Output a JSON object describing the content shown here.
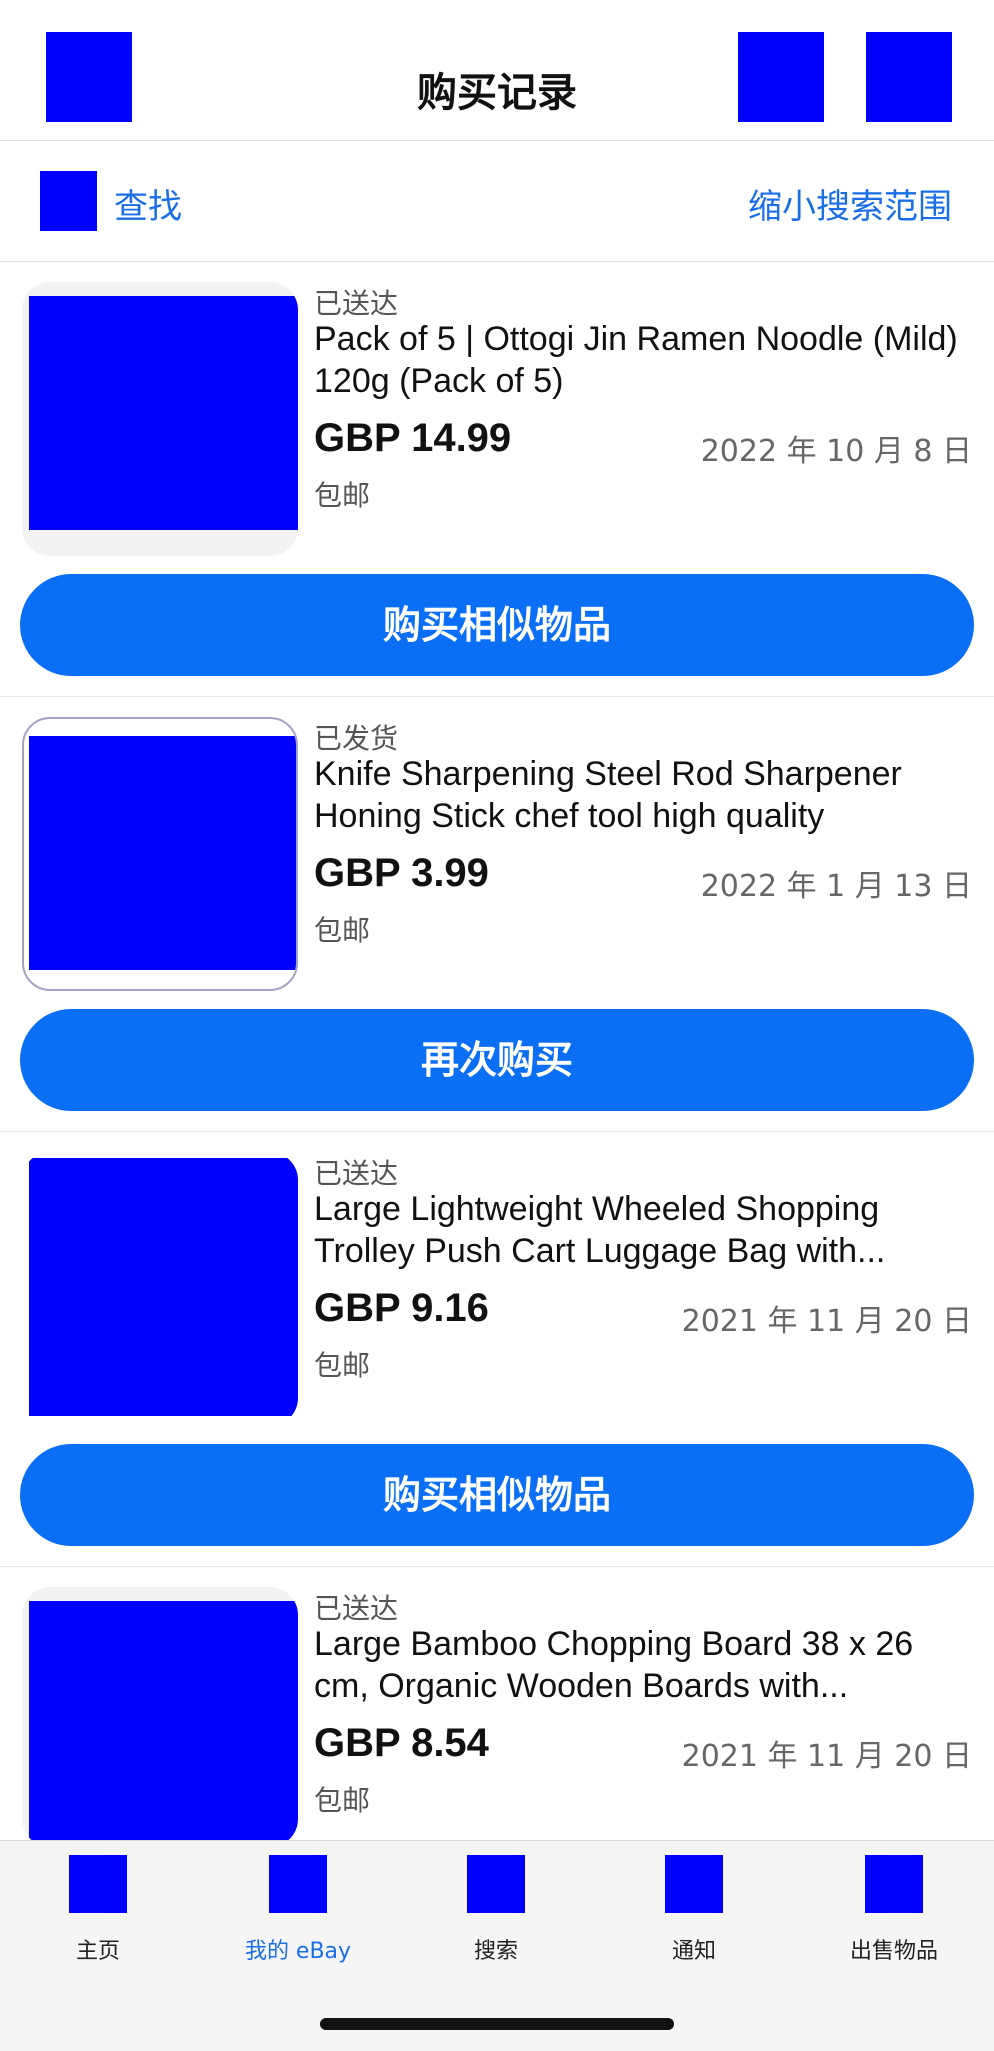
{
  "header": {
    "title": "购买记录",
    "back_icon": "back-arrow-icon",
    "action1_icon": "search-icon",
    "action2_icon": "cart-icon"
  },
  "search": {
    "find_label": "查找",
    "refine_label": "缩小搜索范围",
    "icon": "search-icon"
  },
  "orders": [
    {
      "status": "已送达",
      "name": "Pack of 5 | Ottogi Jin Ramen Noodle (Mild) 120g (Pack of 5)",
      "price": "GBP 14.99",
      "date": "2022 年 10 月 8 日",
      "shipping": "包邮",
      "button": "购买相似物品"
    },
    {
      "status": "已发货",
      "name": "Knife Sharpening Steel Rod Sharpener Honing Stick chef tool high quality",
      "price": "GBP 3.99",
      "date": "2022 年 1 月 13 日",
      "shipping": "包邮",
      "button": "再次购买"
    },
    {
      "status": "已送达",
      "name": "Large Lightweight Wheeled Shopping Trolley Push Cart Luggage Bag with...",
      "price": "GBP 9.16",
      "date": "2021 年 11 月 20 日",
      "shipping": "包邮",
      "button": "购买相似物品"
    },
    {
      "status": "已送达",
      "name": "Large Bamboo Chopping Board 38 x 26 cm, Organic Wooden Boards with...",
      "price": "GBP 8.54",
      "date": "2021 年 11 月 20 日",
      "shipping": "包邮"
    }
  ],
  "tabs": [
    {
      "label": "主页",
      "icon": "home-icon"
    },
    {
      "label": "我的 eBay",
      "icon": "profile-icon",
      "active": true
    },
    {
      "label": "搜索",
      "icon": "search-icon"
    },
    {
      "label": "通知",
      "icon": "bell-icon"
    },
    {
      "label": "出售物品",
      "icon": "tag-icon"
    }
  ],
  "colors": {
    "accent": "#0b6ff5",
    "link": "#1a6fe6",
    "placeholder": "#0000ff"
  }
}
